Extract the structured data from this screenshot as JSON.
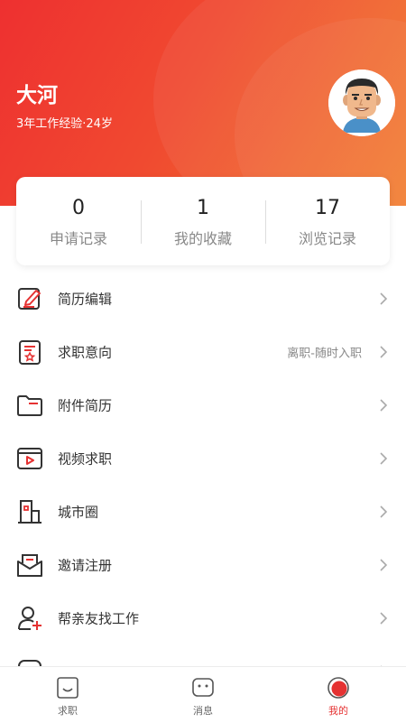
{
  "profile": {
    "name": "大河",
    "meta": "3年工作经验·24岁"
  },
  "stats": [
    {
      "value": "0",
      "label": "申请记录"
    },
    {
      "value": "1",
      "label": "我的收藏"
    },
    {
      "value": "17",
      "label": "浏览记录"
    }
  ],
  "menu": [
    {
      "label": "简历编辑",
      "icon": "resume-edit-icon",
      "value": ""
    },
    {
      "label": "求职意向",
      "icon": "job-intention-icon",
      "value": "离职-随时入职"
    },
    {
      "label": "附件简历",
      "icon": "folder-icon",
      "value": ""
    },
    {
      "label": "视频求职",
      "icon": "video-icon",
      "value": ""
    },
    {
      "label": "城市圈",
      "icon": "building-icon",
      "value": ""
    },
    {
      "label": "邀请注册",
      "icon": "mail-icon",
      "value": ""
    },
    {
      "label": "帮亲友找工作",
      "icon": "add-person-icon",
      "value": ""
    }
  ],
  "tabs": [
    {
      "label": "求职",
      "icon": "smile-face-icon",
      "active": false
    },
    {
      "label": "消息",
      "icon": "message-icon",
      "active": false
    },
    {
      "label": "我的",
      "icon": "profile-icon",
      "active": true
    }
  ],
  "colors": {
    "accent": "#e53232",
    "header_start": "#ee3030",
    "header_end": "#f27a2a"
  }
}
